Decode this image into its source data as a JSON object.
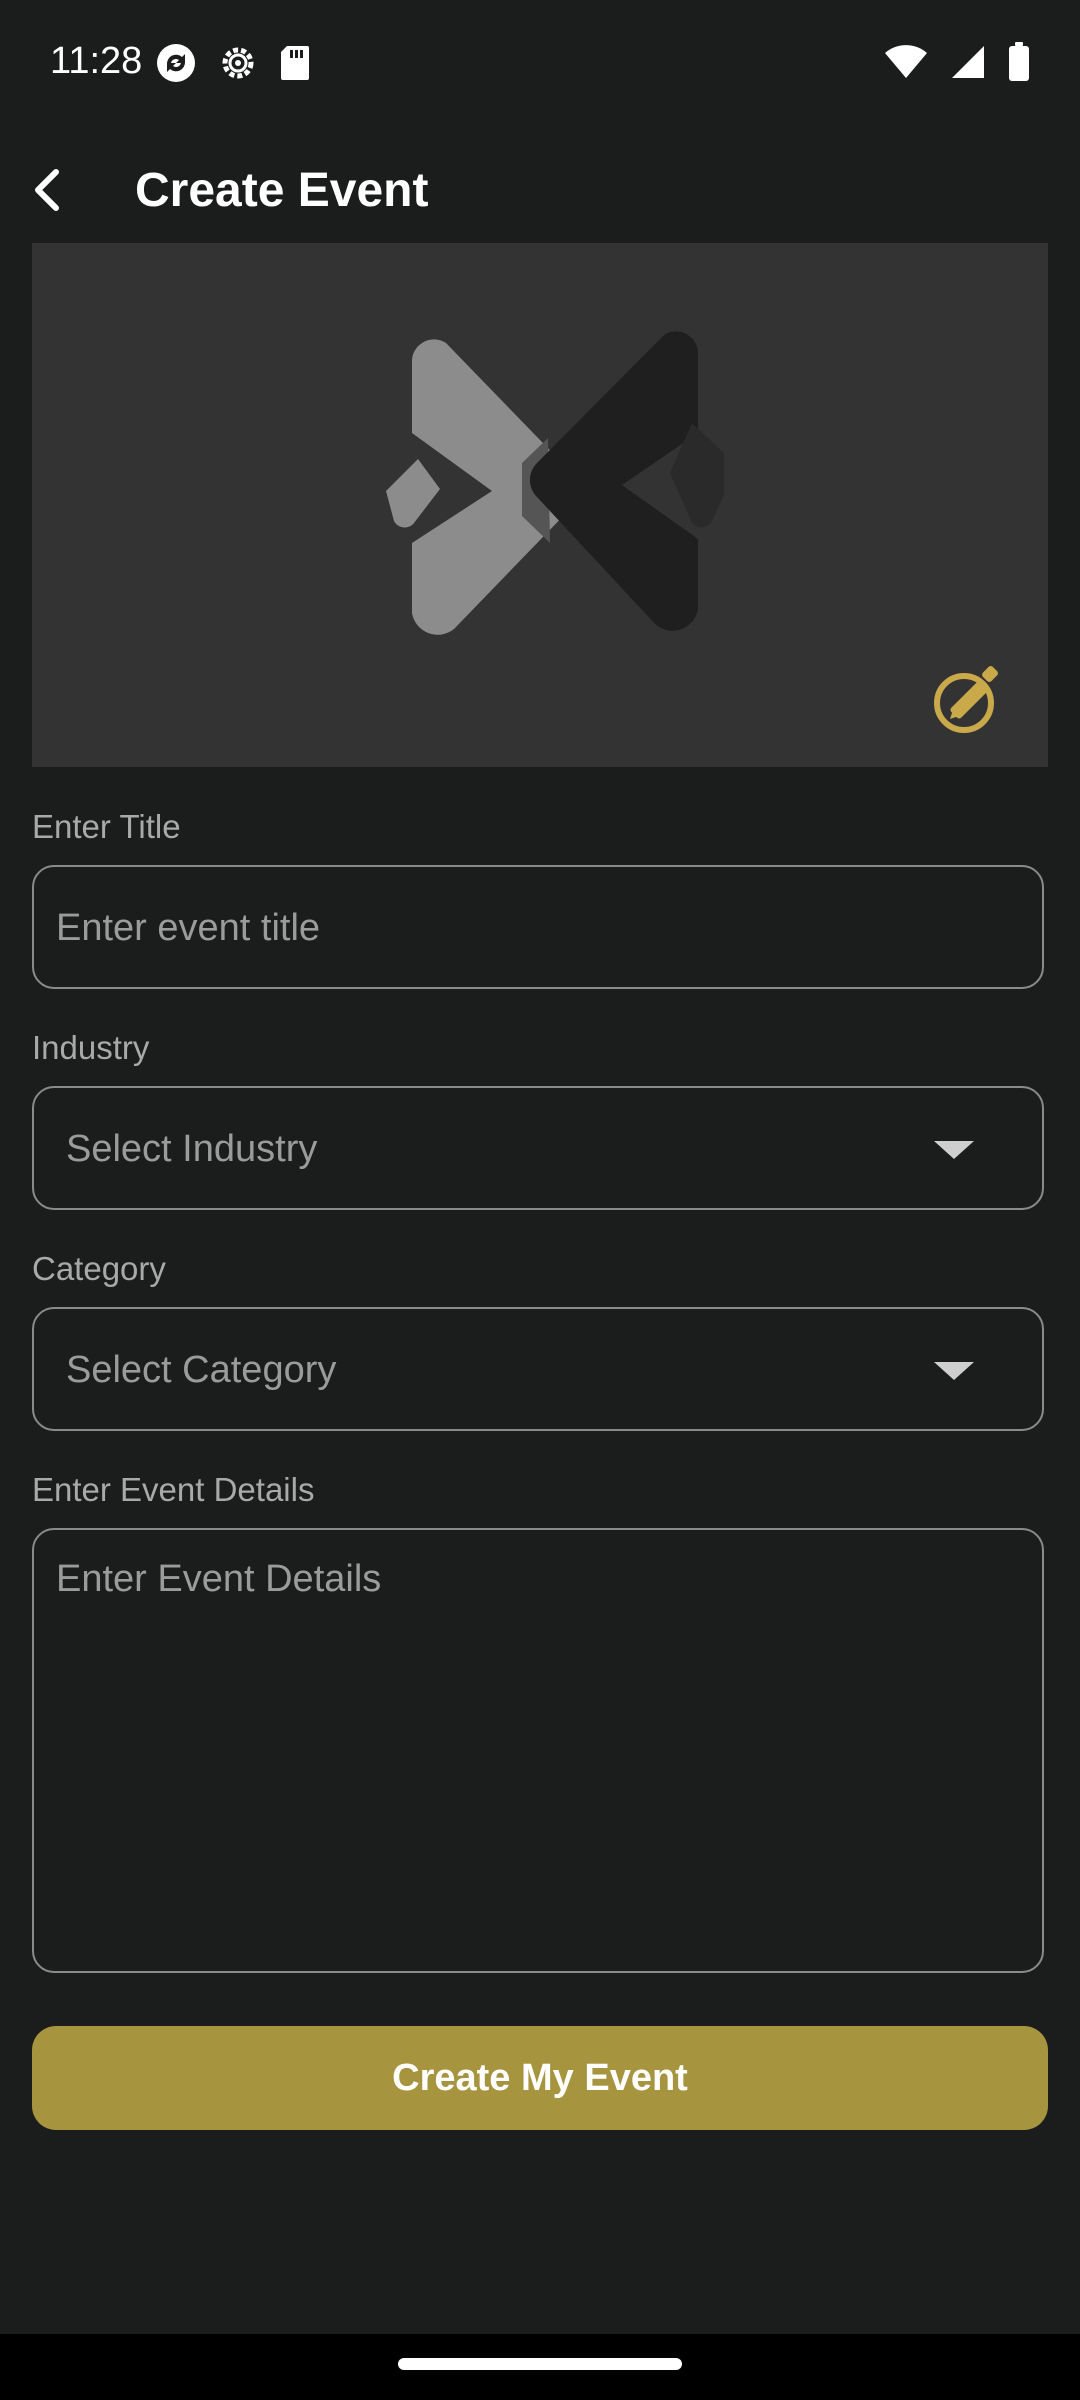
{
  "status_bar": {
    "time": "11:28",
    "left_icons": [
      "sync-icon",
      "settings-gear-icon",
      "sd-card-icon"
    ],
    "right_icons": [
      "wifi-icon",
      "cell-signal-icon",
      "battery-icon"
    ]
  },
  "app_bar": {
    "title": "Create Event",
    "back_icon": "arrow-back-icon"
  },
  "banner": {
    "logo_icon": "app-logo-chevrons-icon",
    "edit_icon": "edit-pencil-icon",
    "accent_color": "#c9a94a"
  },
  "form": {
    "title_label": "Enter Title",
    "title_placeholder": "Enter event title",
    "title_value": "",
    "industry_label": "Industry",
    "industry_selected": "Select Industry",
    "category_label": "Category",
    "category_selected": "Select Category",
    "details_label": "Enter Event Details",
    "details_placeholder": "Enter Event Details",
    "details_value": ""
  },
  "actions": {
    "create_label": "Create My Event",
    "create_color": "#a6943f"
  }
}
